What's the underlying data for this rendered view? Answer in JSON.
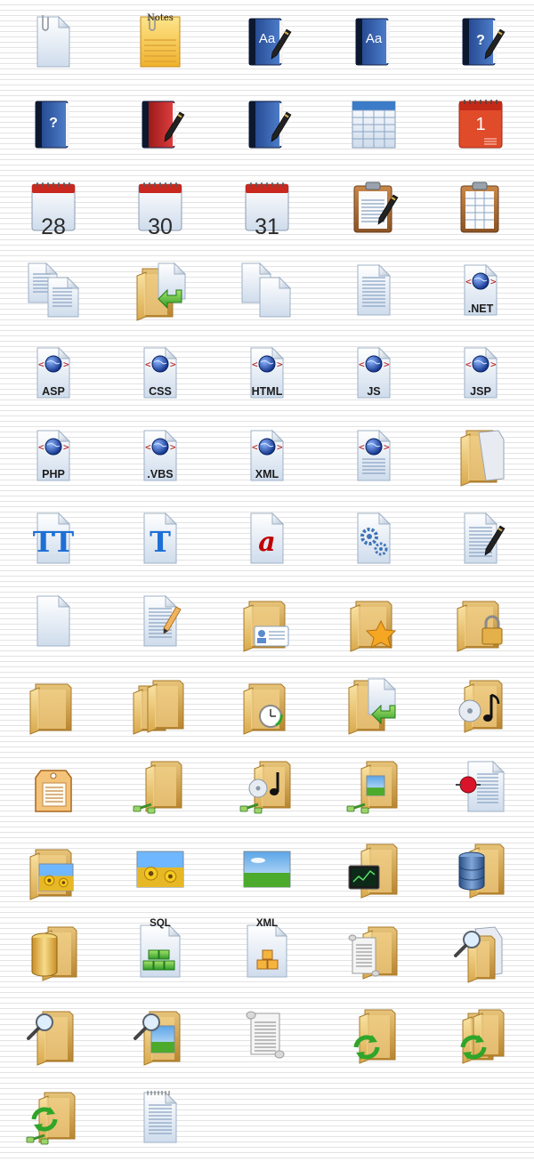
{
  "icons": [
    {
      "icon": "blank-document-clip-icon"
    },
    {
      "icon": "notes-icon",
      "label": "Notes",
      "style": "notes"
    },
    {
      "icon": "dictionary-book-edit-icon",
      "label": "Aa",
      "style": "aa"
    },
    {
      "icon": "dictionary-book-icon",
      "label": "Aa",
      "style": "aa"
    },
    {
      "icon": "help-book-edit-icon",
      "label": "?",
      "style": "q"
    },
    {
      "icon": "help-book-icon",
      "label": "?",
      "style": "q"
    },
    {
      "icon": "red-book-edit-icon"
    },
    {
      "icon": "blue-book-edit-icon"
    },
    {
      "icon": "table-icon"
    },
    {
      "icon": "calendar-day-1-icon",
      "label": "1",
      "style": "one"
    },
    {
      "icon": "calendar-day-28-icon",
      "label": "28",
      "style": "big"
    },
    {
      "icon": "calendar-day-30-icon",
      "label": "30",
      "style": "big"
    },
    {
      "icon": "calendar-day-31-icon",
      "label": "31",
      "style": "big"
    },
    {
      "icon": "clipboard-edit-icon"
    },
    {
      "icon": "clipboard-table-icon"
    },
    {
      "icon": "copy-documents-icon"
    },
    {
      "icon": "folder-import-icon"
    },
    {
      "icon": "duplicate-blank-documents-icon"
    },
    {
      "icon": "text-document-icon"
    },
    {
      "icon": "dotnet-web-file-icon",
      "label": ".NET",
      "style": "type"
    },
    {
      "icon": "asp-web-file-icon",
      "label": "ASP",
      "style": "type"
    },
    {
      "icon": "css-web-file-icon",
      "label": "CSS",
      "style": "type"
    },
    {
      "icon": "html-web-file-icon",
      "label": "HTML",
      "style": "type"
    },
    {
      "icon": "js-web-file-icon",
      "label": "JS",
      "style": "type"
    },
    {
      "icon": "jsp-web-file-icon",
      "label": "JSP",
      "style": "type"
    },
    {
      "icon": "php-web-file-icon",
      "label": "PHP",
      "style": "type"
    },
    {
      "icon": "vbs-web-file-icon",
      "label": ".VBS",
      "style": "type"
    },
    {
      "icon": "xml-web-file-icon",
      "label": "XML",
      "style": "type"
    },
    {
      "icon": "web-document-icon"
    },
    {
      "icon": "folder-document-icon"
    },
    {
      "icon": "truetype-font-icon",
      "label": "TT",
      "style": "tt"
    },
    {
      "icon": "type-font-icon",
      "label": "T",
      "style": "tt"
    },
    {
      "icon": "font-file-icon",
      "label": "a",
      "style": "a"
    },
    {
      "icon": "settings-file-icon"
    },
    {
      "icon": "write-document-icon"
    },
    {
      "icon": "blank-document-icon"
    },
    {
      "icon": "edit-document-pencil-icon"
    },
    {
      "icon": "folder-contact-card-icon"
    },
    {
      "icon": "folder-favorite-star-icon"
    },
    {
      "icon": "folder-locked-icon"
    },
    {
      "icon": "folder-icon"
    },
    {
      "icon": "folders-icon"
    },
    {
      "icon": "folder-history-clock-icon"
    },
    {
      "icon": "folder-move-document-icon"
    },
    {
      "icon": "folder-music-cd-icon"
    },
    {
      "icon": "tag-label-icon"
    },
    {
      "icon": "network-folder-icon"
    },
    {
      "icon": "network-music-folder-icon"
    },
    {
      "icon": "network-picture-folder-icon"
    },
    {
      "icon": "document-record-icon"
    },
    {
      "icon": "folder-pictures-icon"
    },
    {
      "icon": "sunflower-picture-icon"
    },
    {
      "icon": "landscape-picture-icon"
    },
    {
      "icon": "folder-monitor-icon"
    },
    {
      "icon": "folder-database-icon"
    },
    {
      "icon": "folder-cylinder-icon"
    },
    {
      "icon": "sql-file-icon",
      "label": "SQL",
      "style": "top"
    },
    {
      "icon": "xml-data-file-icon",
      "label": "XML",
      "style": "top"
    },
    {
      "icon": "folder-scroll-icon"
    },
    {
      "icon": "search-document-icon"
    },
    {
      "icon": "search-folder-icon"
    },
    {
      "icon": "search-pictures-folder-icon"
    },
    {
      "icon": "scroll-icon"
    },
    {
      "icon": "sync-folder-icon"
    },
    {
      "icon": "sync-folders-icon"
    },
    {
      "icon": "network-sync-folder-icon"
    },
    {
      "icon": "notepad-document-icon"
    }
  ]
}
